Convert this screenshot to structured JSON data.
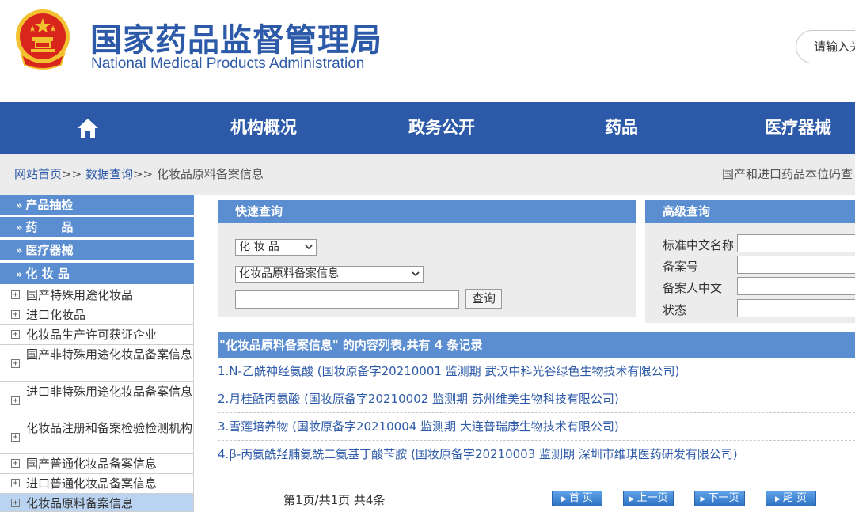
{
  "header": {
    "title_cn": "国家药品监督管理局",
    "title_en": "National Medical Products Administration",
    "search_placeholder": "请输入关"
  },
  "nav": {
    "items": [
      "机构概况",
      "政务公开",
      "药品",
      "医疗器械"
    ]
  },
  "breadcrumb": {
    "home": "网站首页",
    "sep": ">>",
    "data_query": "数据查询",
    "current": "化妆品原料备案信息",
    "right_text": "国产和进口药品本位码查"
  },
  "sidebar": {
    "categories": [
      "产品抽检",
      "药　　品",
      "医疗器械",
      "化 妆 品"
    ],
    "cat_marker": "»",
    "items": [
      "国产特殊用途化妆品",
      "进口化妆品",
      "化妆品生产许可获证企业",
      "国产非特殊用途化妆品备案信息",
      "进口非特殊用途化妆品备案信息",
      "化妆品注册和备案检验检测机构",
      "国产普通化妆品备案信息",
      "进口普通化妆品备案信息",
      "化妆品原料备案信息"
    ],
    "plus": "+"
  },
  "quick_search": {
    "title": "快速查询",
    "select1": "化 妆 品",
    "select2": "化妆品原料备案信息",
    "button": "查询"
  },
  "advanced_search": {
    "title": "高级查询",
    "labels": [
      "标准中文名称",
      "备案号",
      "备案人中文",
      "状态"
    ]
  },
  "results": {
    "header": "\"化妆品原料备案信息\" 的内容列表,共有 4 条记录",
    "rows": [
      "1.N-乙酰神经氨酸 (国妆原备字20210001 监测期 武汉中科光谷绿色生物技术有限公司)",
      "2.月桂酰丙氨酸 (国妆原备字20210002 监测期 苏州维美生物科技有限公司)",
      "3.雪莲培养物 (国妆原备字20210004 监测期 大连普瑞康生物技术有限公司)",
      "4.β-丙氨酰羟脯氨酰二氨基丁酸苄胺 (国妆原备字20210003 监测期 深圳市维琪医药研发有限公司)"
    ]
  },
  "pagination": {
    "info": "第1页/共1页 共4条",
    "first": "首 页",
    "prev": "上一页",
    "next": "下一页",
    "last": "尾 页",
    "tri": "▶"
  },
  "colors": {
    "brand_blue": "#2d5aa8",
    "panel_blue": "#5b8ed0",
    "emblem_red": "#d8261c",
    "emblem_gold": "#f2c230"
  }
}
